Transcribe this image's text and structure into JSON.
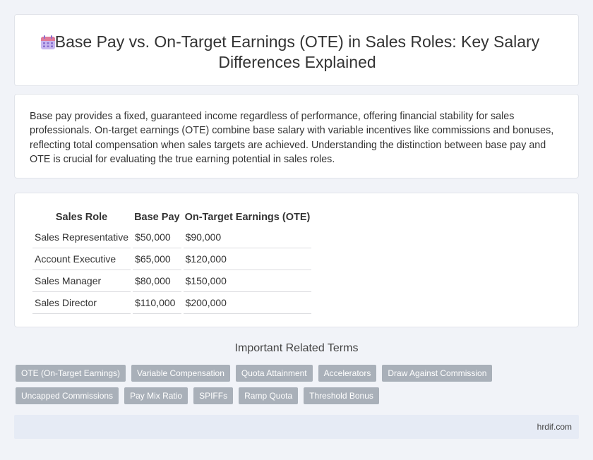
{
  "header": {
    "title": "Base Pay vs. On-Target Earnings (OTE) in Sales Roles: Key Salary Differences Explained",
    "icon": "calendar-icon"
  },
  "intro": {
    "text": "Base pay provides a fixed, guaranteed income regardless of performance, offering financial stability for sales professionals. On-target earnings (OTE) combine base salary with variable incentives like commissions and bonuses, reflecting total compensation when sales targets are achieved. Understanding the distinction between base pay and OTE is crucial for evaluating the true earning potential in sales roles."
  },
  "table": {
    "headers": [
      "Sales Role",
      "Base Pay",
      "On-Target Earnings (OTE)"
    ],
    "rows": [
      [
        "Sales Representative",
        "$50,000",
        "$90,000"
      ],
      [
        "Account Executive",
        "$65,000",
        "$120,000"
      ],
      [
        "Sales Manager",
        "$80,000",
        "$150,000"
      ],
      [
        "Sales Director",
        "$110,000",
        "$200,000"
      ]
    ]
  },
  "related": {
    "title": "Important Related Terms",
    "tags_row1": [
      "OTE (On-Target Earnings)",
      "Variable Compensation",
      "Quota Attainment",
      "Accelerators",
      "Draw Against Commission"
    ],
    "tags_row2": [
      "Uncapped Commissions",
      "Pay Mix Ratio",
      "SPIFFs",
      "Ramp Quota",
      "Threshold Bonus"
    ]
  },
  "footer": {
    "site": "hrdif.com"
  },
  "colors": {
    "background": "#f1f3f8",
    "tag": "#a9b0b9",
    "footer": "#e6ebf5",
    "icon_top": "#e07a9a",
    "icon_body": "#b9a6e8"
  }
}
